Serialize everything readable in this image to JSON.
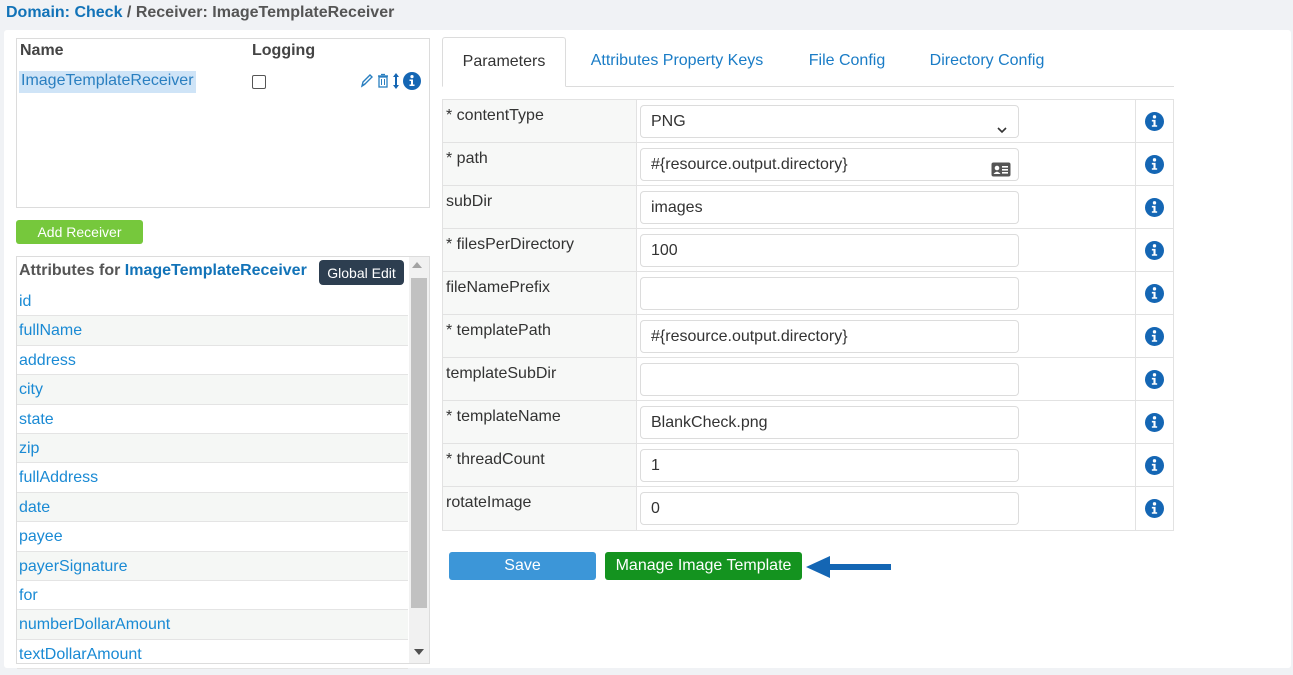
{
  "breadcrumb": {
    "domain_label": "Domain: Check",
    "separator": " / ",
    "receiver_label": "Receiver: ImageTemplateReceiver"
  },
  "receivers": {
    "col_name": "Name",
    "col_logging": "Logging",
    "items": [
      {
        "name": "ImageTemplateReceiver",
        "logging": false
      }
    ],
    "icons": [
      "edit-icon",
      "trash-icon",
      "sort-icon",
      "info-icon"
    ]
  },
  "add_receiver_label": "Add Receiver",
  "attributes": {
    "title_prefix": "Attributes for ",
    "title_name": "ImageTemplateReceiver",
    "global_edit_label": "Global Edit",
    "items": [
      "id",
      "fullName",
      "address",
      "city",
      "state",
      "zip",
      "fullAddress",
      "date",
      "payee",
      "payerSignature",
      "for",
      "numberDollarAmount",
      "textDollarAmount"
    ]
  },
  "tabs": [
    "Parameters",
    "Attributes Property Keys",
    "File Config",
    "Directory Config"
  ],
  "params": [
    {
      "label": "* contentType",
      "value": "PNG",
      "kind": "select"
    },
    {
      "label": "* path",
      "value": "#{resource.output.directory}",
      "kind": "card"
    },
    {
      "label": "subDir",
      "value": "images",
      "kind": "text"
    },
    {
      "label": "* filesPerDirectory",
      "value": "100",
      "kind": "text"
    },
    {
      "label": "fileNamePrefix",
      "value": "",
      "kind": "text"
    },
    {
      "label": "* templatePath",
      "value": "#{resource.output.directory}",
      "kind": "text"
    },
    {
      "label": "templateSubDir",
      "value": "",
      "kind": "text"
    },
    {
      "label": "* templateName",
      "value": "BlankCheck.png",
      "kind": "text"
    },
    {
      "label": "* threadCount",
      "value": "1",
      "kind": "text"
    },
    {
      "label": "rotateImage",
      "value": "0",
      "kind": "text"
    }
  ],
  "buttons": {
    "save": "Save",
    "manage_image_template": "Manage Image Template"
  },
  "colors": {
    "link": "#1273b8",
    "add_green": "#76c83c",
    "save_blue": "#3c96d8",
    "manage_green": "#14931f",
    "arrow_blue": "#1466b4",
    "info_blue": "#1466b4"
  }
}
